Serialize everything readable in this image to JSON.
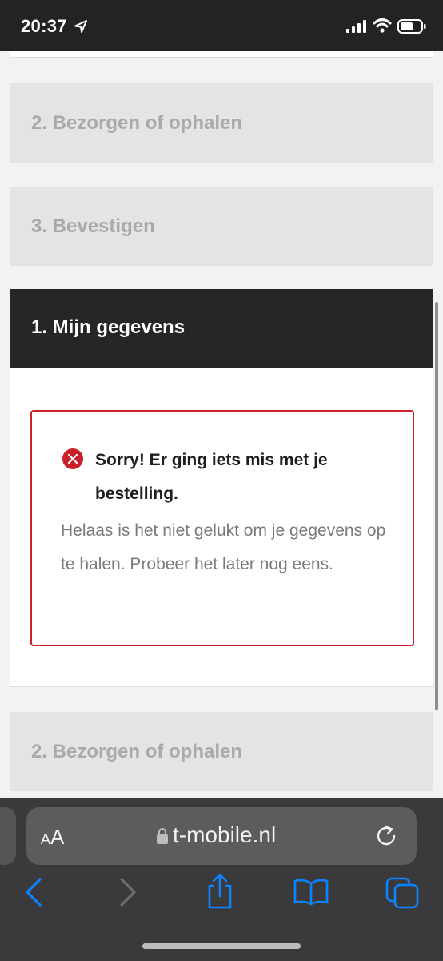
{
  "status_bar": {
    "time": "20:37"
  },
  "steps": {
    "collapsed_top": [
      {
        "label": "2. Bezorgen of ophalen"
      },
      {
        "label": "3. Bevestigen"
      }
    ],
    "active": {
      "label": "1. Mijn gegevens",
      "error": {
        "title": "Sorry! Er ging iets mis met je bestelling.",
        "message": "Helaas is het niet gelukt om je gegevens op te halen. Probeer het later nog eens."
      }
    },
    "collapsed_bottom": [
      {
        "label": "2. Bezorgen of ophalen"
      }
    ]
  },
  "browser": {
    "text_size_label_small": "A",
    "text_size_label_large": "A",
    "url": "t-mobile.nl"
  },
  "colors": {
    "accent_blue": "#0a84ff",
    "error_red": "#c9202a",
    "header_dark": "#262626"
  }
}
